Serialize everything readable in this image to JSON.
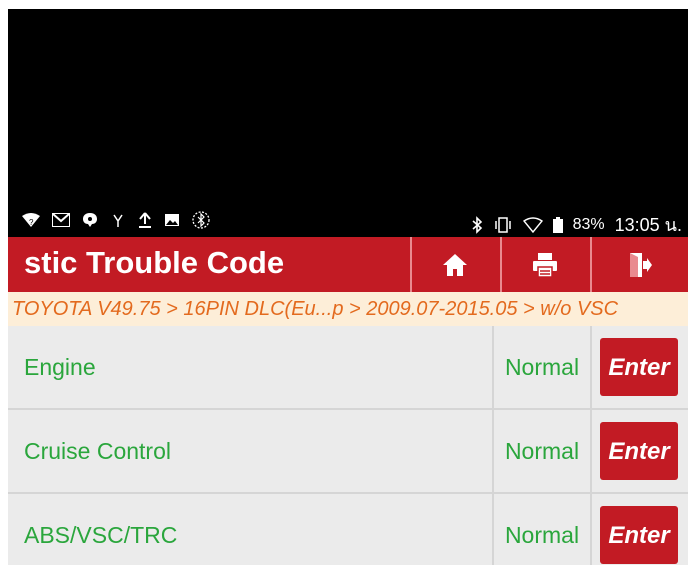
{
  "status_bar": {
    "battery_percent": "83%",
    "time": "13:05 น."
  },
  "header": {
    "title": "stic Trouble Code",
    "home_icon": "home-icon",
    "print_icon": "printer-icon",
    "exit_icon": "exit-icon"
  },
  "breadcrumb": "TOYOTA V49.75 > 16PIN DLC(Eu...p > 2009.07-2015.05 > w/o VSC",
  "systems": [
    {
      "name": "Engine",
      "status": "Normal",
      "action": "Enter"
    },
    {
      "name": "Cruise Control",
      "status": "Normal",
      "action": "Enter"
    },
    {
      "name": "ABS/VSC/TRC",
      "status": "Normal",
      "action": "Enter"
    }
  ],
  "colors": {
    "header_red": "#c21b24",
    "status_green": "#2aa63c",
    "breadcrumb_orange": "#e36a1e",
    "breadcrumb_bg": "#fdeed8"
  }
}
